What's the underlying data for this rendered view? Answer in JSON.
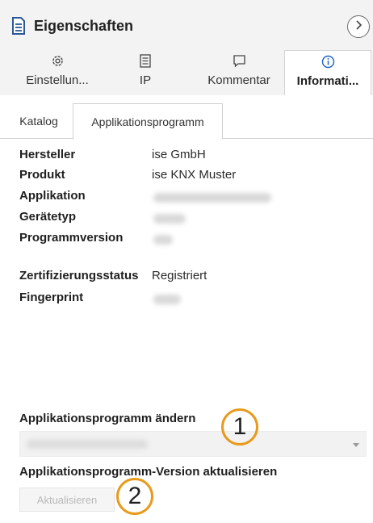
{
  "header": {
    "title": "Eigenschaften",
    "doc_icon": "document-icon",
    "collapse_icon": "chevron-right-icon"
  },
  "tabs": [
    {
      "label": "Einstellun...",
      "icon": "gear-icon",
      "active": false
    },
    {
      "label": "IP",
      "icon": "list-icon",
      "active": false
    },
    {
      "label": "Kommentar",
      "icon": "comment-icon",
      "active": false
    },
    {
      "label": "Informati...",
      "icon": "info-icon",
      "active": true
    }
  ],
  "subtabs": [
    {
      "label": "Katalog",
      "active": false
    },
    {
      "label": "Applikationsprogramm",
      "active": true
    }
  ],
  "properties": [
    {
      "key": "Hersteller",
      "value": "ise GmbH",
      "blurred": false
    },
    {
      "key": "Produkt",
      "value": "ise KNX Muster",
      "blurred": false
    },
    {
      "key": "Applikation",
      "value": "",
      "blurred": true
    },
    {
      "key": "Gerätetyp",
      "value": "",
      "blurred": true
    },
    {
      "key": "Programmversion",
      "value": "",
      "blurred": true
    },
    {
      "key": "Zertifizierungsstatus",
      "value": "Registriert",
      "blurred": false
    },
    {
      "key": "Fingerprint",
      "value": "",
      "blurred": true
    }
  ],
  "change_section": {
    "label": "Applikationsprogramm ändern",
    "dropdown_value": ""
  },
  "update_section": {
    "label": "Applikationsprogramm-Version aktualisieren",
    "button_label": "Aktualisieren"
  },
  "callouts": [
    "1",
    "2"
  ],
  "colors": {
    "accent": "#e89a1c",
    "panel_bg": "#f3f3f3",
    "active_tab_bg": "#ffffff",
    "disabled_text": "#b9b9b9"
  }
}
